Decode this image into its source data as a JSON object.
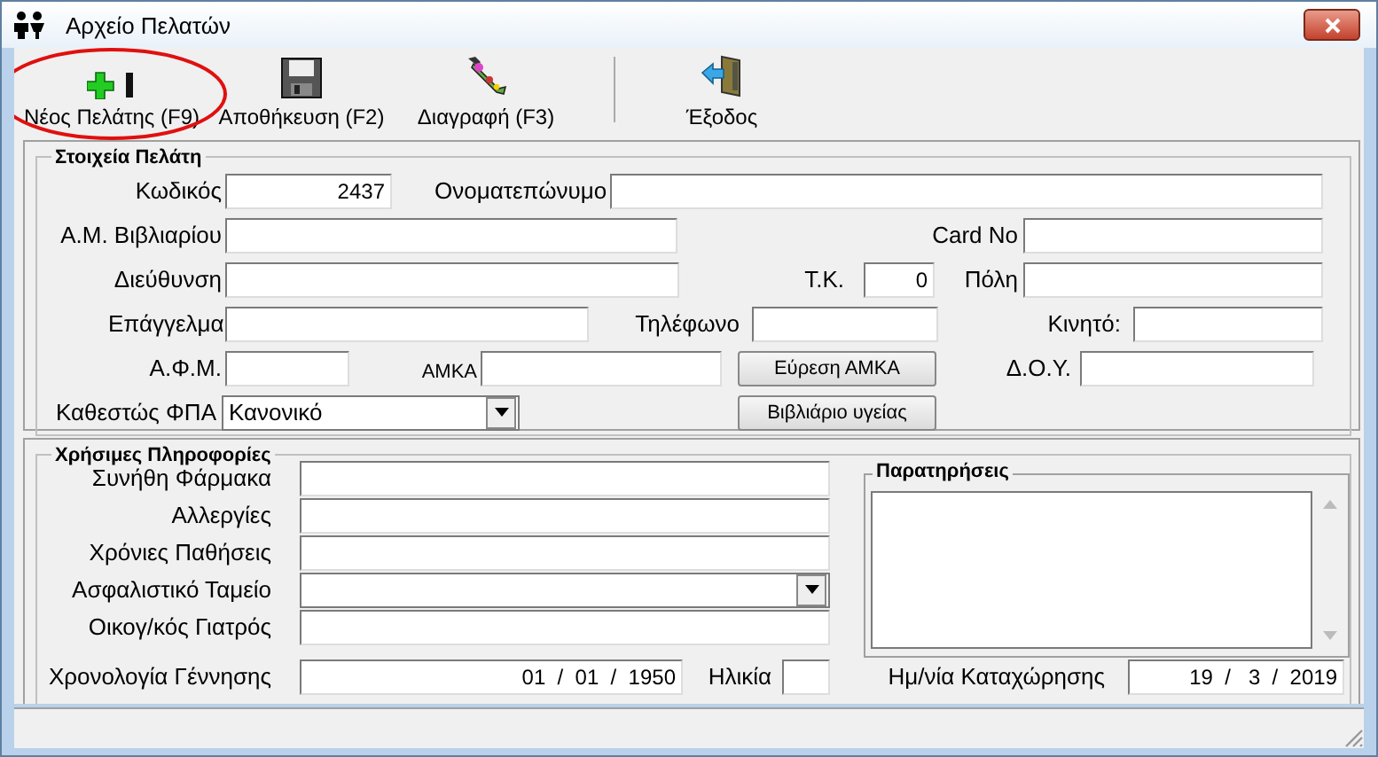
{
  "window": {
    "title": "Αρχείο Πελατών"
  },
  "toolbar": [
    {
      "label": "Νέος Πελάτης (F9)",
      "kind": "new",
      "circled": true
    },
    {
      "label": "Αποθήκευση (F2)",
      "kind": "save",
      "circled": false
    },
    {
      "label": "Διαγραφή (F3)",
      "kind": "delete",
      "circled": false
    },
    {
      "label": "Έξοδος",
      "kind": "exit",
      "circled": false
    }
  ],
  "customer_panel": {
    "title": "Στοιχεία Πελάτη",
    "rows": [
      [
        {
          "kind": "number",
          "label": "Κωδικός",
          "value": "2437"
        },
        {
          "kind": "text",
          "label": "Ονοματεπώνυμο"
        }
      ],
      [
        {
          "kind": "text",
          "label": "Α.Μ. Βιβλιαρίου"
        },
        {
          "kind": "text",
          "label": "Card No"
        }
      ],
      [
        {
          "kind": "text",
          "label": "Διεύθυνση"
        },
        {
          "kind": "number",
          "label": "Τ.Κ.",
          "value": "0"
        },
        {
          "kind": "text",
          "label": "Πόλη"
        }
      ],
      [
        {
          "kind": "text",
          "label": "Επάγγελμα"
        },
        {
          "kind": "text",
          "label": "Τηλέφωνο"
        },
        {
          "kind": "text",
          "label": "Κινητό:"
        }
      ],
      [
        {
          "kind": "text",
          "label": "Α.Φ.Μ."
        },
        {
          "kind": "text",
          "label": "ΑΜΚΑ",
          "small": true
        },
        {
          "kind": "button",
          "label": "Εύρεση ΑΜΚΑ"
        },
        {
          "kind": "text",
          "label": "Δ.Ο.Υ."
        }
      ],
      [
        {
          "kind": "select",
          "label": "Καθεστώς ΦΠΑ",
          "value": "Κανονικό"
        },
        {
          "kind": "button",
          "label": "Βιβλιάριο υγείας"
        }
      ]
    ]
  },
  "info_panel": {
    "title": "Χρήσιμες Πληροφορίες",
    "rows": [
      [
        {
          "kind": "text",
          "label": "Συνήθη Φάρμακα"
        }
      ],
      [
        {
          "kind": "text",
          "label": "Αλλεργίες"
        }
      ],
      [
        {
          "kind": "text",
          "label": "Χρόνιες Παθήσεις"
        }
      ],
      [
        {
          "kind": "select",
          "label": "Ασφαλιστικό Ταμείο"
        }
      ],
      [
        {
          "kind": "text",
          "label": "Οικογ/κός Γιατρός"
        }
      ],
      [
        {
          "kind": "date",
          "label": "Χρονολογία Γέννησης",
          "value": "01  /  01  /  1950"
        },
        {
          "kind": "text",
          "label": "Ηλικία"
        },
        {
          "kind": "date",
          "label": "Ημ/νία Καταχώρησης",
          "value": "19  /   3  /  2019"
        }
      ]
    ],
    "remarks": {
      "title": "Παρατηρήσεις"
    }
  }
}
